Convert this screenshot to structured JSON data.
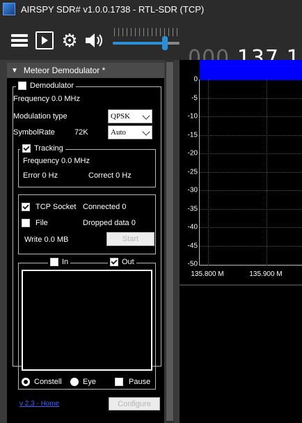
{
  "window": {
    "title": "AIRSPY SDR# v1.0.0.1738 - RTL-SDR (TCP)"
  },
  "toolbar": {
    "menu_icon": "hamburger-menu-icon",
    "play_icon": "play-icon",
    "settings_icon": "gear-icon",
    "audio_icon": "speaker-icon",
    "volume_level": 0.78,
    "frequency_dim": "000.",
    "frequency_bright": "137.1"
  },
  "panel": {
    "title": "Meteor Demodulator *",
    "demodulator": {
      "label": "Demodulator",
      "checked": false,
      "frequency": "Frequency 0.0 MHz",
      "modulation_label": "Modulation type",
      "modulation_value": "QPSK",
      "symbolrate_label": "SymbolRate",
      "symbolrate_value": "72K",
      "symbolrate_mode": "Auto"
    },
    "tracking": {
      "label": "Tracking",
      "checked": true,
      "frequency": "Frequency 0.0 MHz",
      "error": "Error 0 Hz",
      "correct": "Correct 0 Hz"
    },
    "output": {
      "tcp_label": "TCP Socket",
      "tcp_checked": true,
      "connected": "Connected 0",
      "file_label": "File",
      "file_checked": false,
      "dropped": "Dropped data 0",
      "write": "Write 0.0 MB",
      "start_label": "Start"
    },
    "constellation": {
      "in_label": "In",
      "in_checked": false,
      "out_label": "Out",
      "out_checked": true,
      "constell_label": "Constell",
      "eye_label": "Eye",
      "pause_label": "Pause",
      "selected_view": "Constell"
    },
    "version_link": "v 2.3 - Home",
    "configure_label": "Configure"
  },
  "spectrum": {
    "y_ticks": [
      "0",
      "-5",
      "-10",
      "-15",
      "-20",
      "-25",
      "-30",
      "-35",
      "-40",
      "-45",
      "-50"
    ],
    "x_ticks": [
      "135.800 M",
      "135.900 M"
    ],
    "waterfall_color": "#0000ff"
  }
}
